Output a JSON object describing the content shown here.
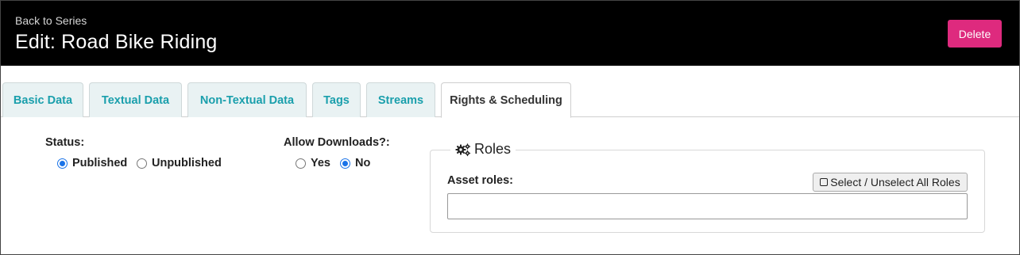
{
  "header": {
    "back_link": "Back to Series",
    "title": "Edit: Road Bike Riding",
    "delete_label": "Delete",
    "delete_color": "#de2a7e"
  },
  "tabs": [
    {
      "label": "Basic Data",
      "active": false
    },
    {
      "label": "Textual Data",
      "active": false
    },
    {
      "label": "Non-Textual Data",
      "active": false
    },
    {
      "label": "Tags",
      "active": false
    },
    {
      "label": "Streams",
      "active": false
    },
    {
      "label": "Rights & Scheduling",
      "active": true
    }
  ],
  "status": {
    "label": "Status:",
    "options": [
      {
        "label": "Published",
        "checked": true
      },
      {
        "label": "Unpublished",
        "checked": false
      }
    ]
  },
  "downloads": {
    "label": "Allow Downloads?:",
    "options": [
      {
        "label": "Yes",
        "checked": false
      },
      {
        "label": "No",
        "checked": true
      }
    ]
  },
  "roles": {
    "legend": "Roles",
    "legend_icon": "gears-icon",
    "asset_roles_label": "Asset roles:",
    "select_all_label": "Select / Unselect All Roles",
    "asset_roles_value": ""
  },
  "colors": {
    "tab_text": "#1a9fac",
    "tab_bg": "#e9f2f3",
    "radio_checked": "#1a73e8"
  }
}
